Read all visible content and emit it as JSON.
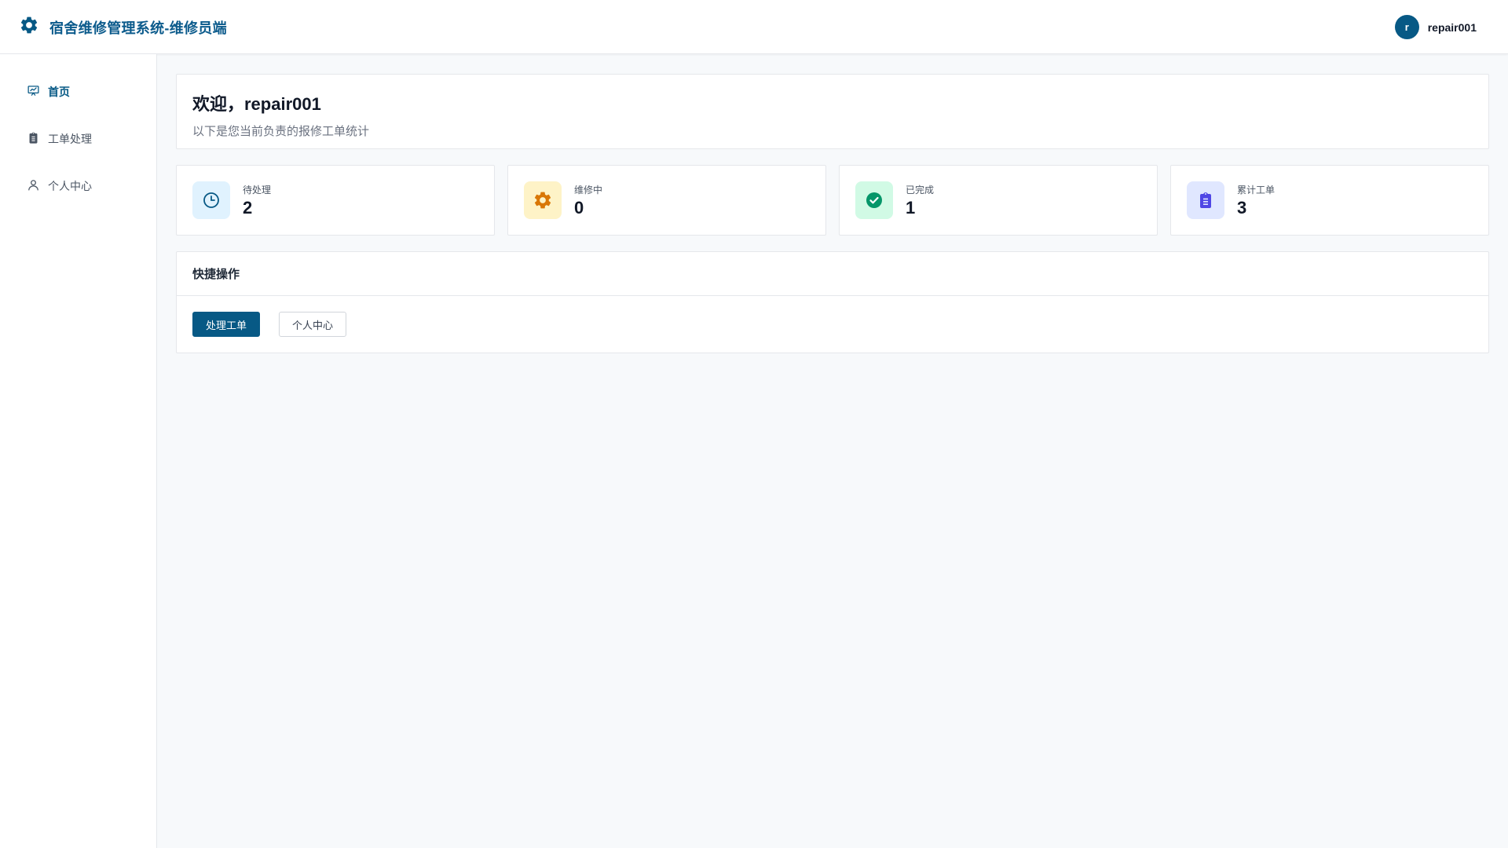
{
  "header": {
    "title": "宿舍维修管理系统-维修员端",
    "user": {
      "avatar_letter": "r",
      "name": "repair001"
    }
  },
  "sidebar": {
    "items": [
      {
        "label": "首页",
        "icon": "dashboard-icon",
        "active": true
      },
      {
        "label": "工单处理",
        "icon": "clipboard-icon",
        "active": false
      },
      {
        "label": "个人中心",
        "icon": "user-icon",
        "active": false
      }
    ]
  },
  "welcome": {
    "title": "欢迎，repair001",
    "subtitle": "以下是您当前负责的报修工单统计"
  },
  "stats": [
    {
      "label": "待处理",
      "value": "2",
      "icon": "clock-icon",
      "bg": "#e0f2fe",
      "color": "#075985"
    },
    {
      "label": "维修中",
      "value": "0",
      "icon": "gear-icon",
      "bg": "#fef3c7",
      "color": "#d97706"
    },
    {
      "label": "已完成",
      "value": "1",
      "icon": "check-circle-icon",
      "bg": "#d1fae5",
      "color": "#059669"
    },
    {
      "label": "累计工单",
      "value": "3",
      "icon": "clipboard-icon",
      "bg": "#e0e7ff",
      "color": "#4f46e5"
    }
  ],
  "quick": {
    "title": "快捷操作",
    "primary_label": "处理工单",
    "secondary_label": "个人中心"
  },
  "colors": {
    "brand": "#075985",
    "page_bg": "#f7f9fb"
  }
}
